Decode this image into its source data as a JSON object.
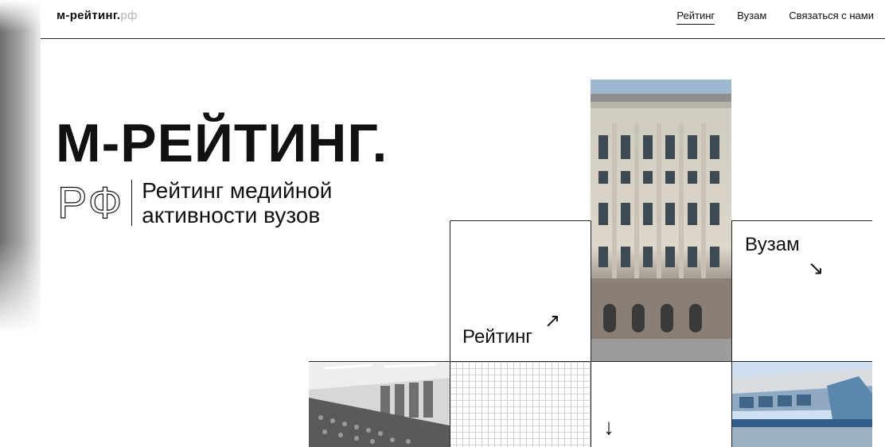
{
  "header": {
    "logo_main": "м-рейтинг.",
    "logo_domain": "рф",
    "nav": [
      {
        "label": "Рейтинг",
        "active": true
      },
      {
        "label": "Вузам",
        "active": false
      },
      {
        "label": "Связаться с нами",
        "active": false
      }
    ]
  },
  "hero": {
    "title": "М-РЕЙТИНГ.",
    "domain": "РФ",
    "subtitle_line1": "Рейтинг медийной",
    "subtitle_line2": "активности вузов"
  },
  "tiles": {
    "rating_label": "Рейтинг",
    "rating_arrow": "↗",
    "univ_label": "Вузам",
    "univ_arrow": "↘",
    "scroll_arrow": "↓"
  }
}
